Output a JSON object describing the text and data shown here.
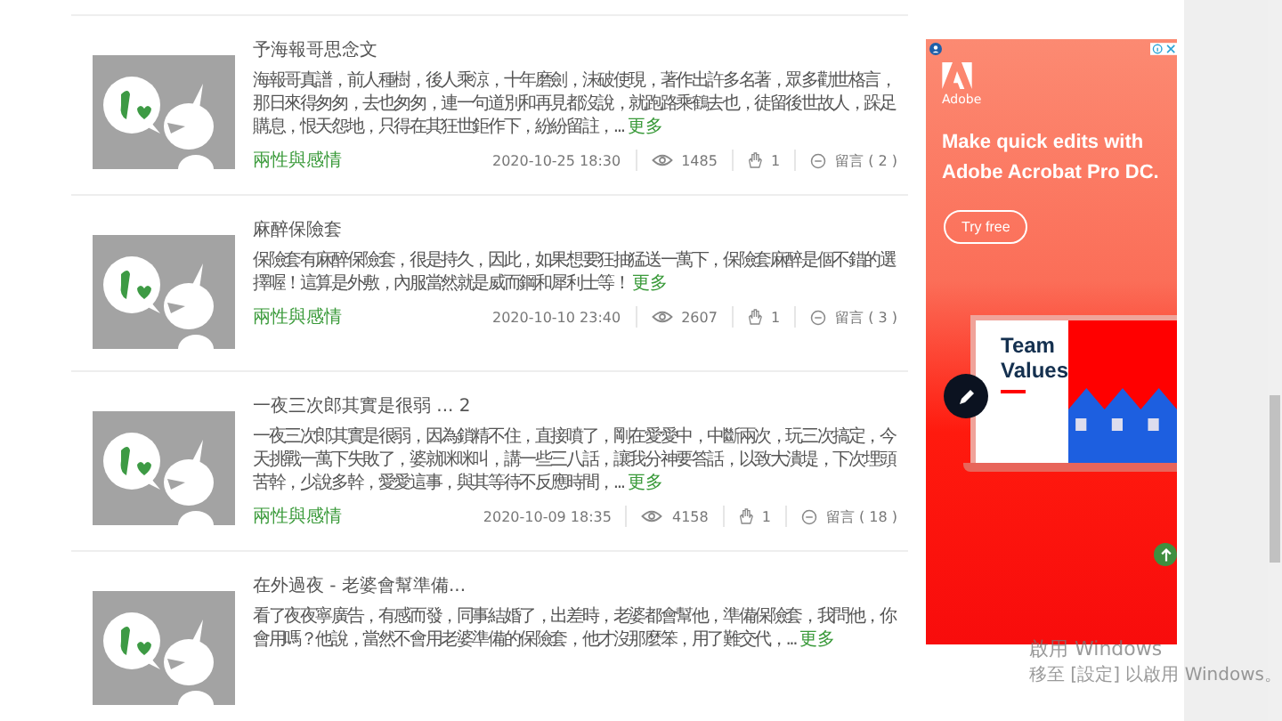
{
  "posts": [
    {
      "title": "予海報哥思念文",
      "excerpt": "海報哥真譜，前人種樹，後人乘涼，十年磨劍，沫破使現，著作出許多名著，眾多勸世格言，那日來得匆匆，去也匆匆，連一句道別和再見都沒說，就跑路乘鶴去也，徒留後世故人，跺足購息，恨天怨地，只得在其狂世鉅作下，紛紛留註，...",
      "more": "更多",
      "tag": "兩性與感情",
      "date": "2020-10-25 18:30",
      "views": "1485",
      "likes": "1",
      "comments": "留言 ( 2 )"
    },
    {
      "title": "麻醉保險套",
      "excerpt": "保險套有麻醉保險套，很是持久，因此，如果想要狂抽猛送一萬下，保險套麻醉是個不錯的選擇喔！這算是外敷，內服當然就是威而鋼和犀利士等！",
      "more": "更多",
      "tag": "兩性與感情",
      "date": "2020-10-10 23:40",
      "views": "2607",
      "likes": "1",
      "comments": "留言 ( 3 )"
    },
    {
      "title": "一夜三次郎其實是很弱 ... 2",
      "excerpt": "一夜三次郎其實是很弱，因為鎖精不住，直接噴了，剛在愛愛中，中斷兩次，玩三次搞定，今天挑戰一萬下失敗了，婆就咪咪叫，講一些三八話，讓我分神要答話，以致大潰堤，下次埋頭苦幹，少說多幹，愛愛這事，與其等待不反應時間，...",
      "more": "更多",
      "tag": "兩性與感情",
      "date": "2020-10-09 18:35",
      "views": "4158",
      "likes": "1",
      "comments": "留言 ( 18 )"
    },
    {
      "title": "在外過夜 - 老婆會幫準備...",
      "excerpt": "看了夜夜寧廣告，有感而發，同事結婚了，出差時，老婆都會幫他，準備保險套，我問他，你會用嗎？他說，當然不會用老婆準備的保險套，他才沒那麼笨，用了難交代，...",
      "more": "更多"
    }
  ],
  "ad": {
    "brand": "Adobe",
    "headline": "Make quick edits with Adobe Acrobat Pro DC.",
    "button": "Try free",
    "slide_title": "Team Values"
  },
  "activation_notice": {
    "title": "啟用 Windows",
    "subtitle": "移至 [設定] 以啟用 Windows。"
  }
}
